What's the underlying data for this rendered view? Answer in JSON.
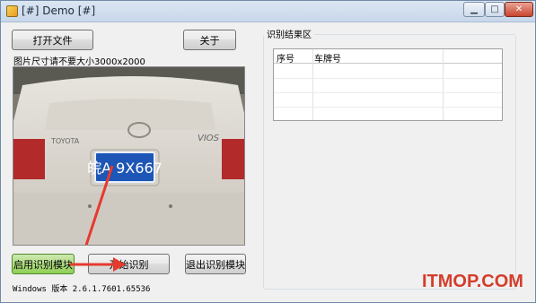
{
  "window": {
    "title": "[#] Demo [#]"
  },
  "buttons": {
    "open_file": "打开文件",
    "about": "关于",
    "enable_module": "启用识别模块",
    "start_recognition": "开始识别",
    "exit_module": "退出识别模块"
  },
  "hint": "图片尺寸请不要大小3000x2000",
  "results": {
    "group_title": "识别结果区",
    "columns": [
      "序号",
      "车牌号"
    ]
  },
  "photo": {
    "plate_text": "皖A 9X667",
    "badge_left": "TOYOTA",
    "badge_right": "VIOS"
  },
  "version": "Windows 版本 2.6.1.7601.65536",
  "watermark": "ITMOP.COM",
  "colors": {
    "accent_green": "#8fcf55",
    "arrow_red": "#e53a2e",
    "plate_blue": "#1d56b6"
  }
}
